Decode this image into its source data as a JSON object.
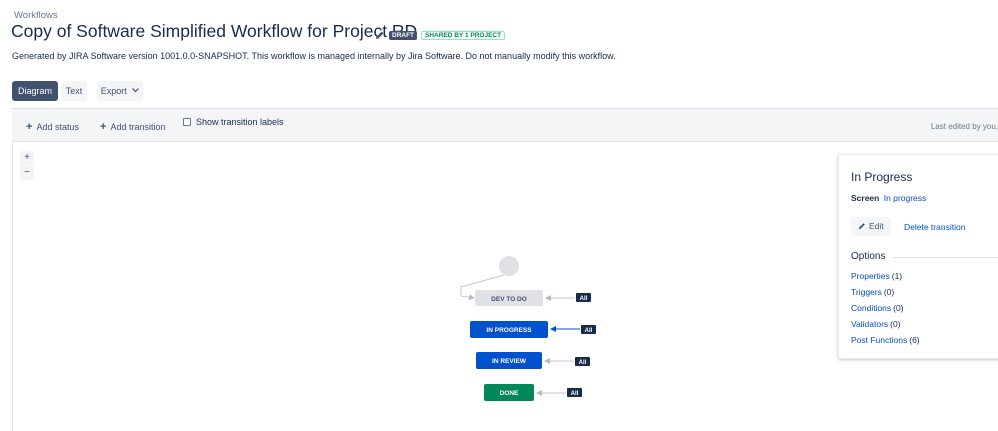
{
  "header": {
    "breadcrumb": "Workflows",
    "title": "Copy of Software Simplified Workflow for Project RD",
    "draft_badge": "DRAFT",
    "shared_badge": "SHARED BY 1 PROJECT",
    "description": "Generated by JIRA Software version 1001.0.0-SNAPSHOT. This workflow is managed internally by Jira Software. Do not manually modify this workflow."
  },
  "tabs": {
    "diagram": "Diagram",
    "text": "Text",
    "export": "Export"
  },
  "toolbar": {
    "add_status": "Add status",
    "add_transition": "Add transition",
    "show_labels": "Show transition labels",
    "show_labels_checked": false,
    "last_edited": "Last edited by you,"
  },
  "zoom": {
    "in": "+",
    "out": "−"
  },
  "statuses": [
    {
      "label": "DEV TO DO",
      "color": "#dfe1e6",
      "text_color": "#42526e",
      "global_label": "All"
    },
    {
      "label": "IN PROGRESS",
      "color": "#0052cc",
      "text_color": "#ffffff",
      "global_label": "All"
    },
    {
      "label": "IN REVIEW",
      "color": "#0052cc",
      "text_color": "#ffffff",
      "global_label": "All"
    },
    {
      "label": "DONE",
      "color": "#00875a",
      "text_color": "#ffffff",
      "global_label": "All"
    }
  ],
  "panel": {
    "title": "In Progress",
    "screen_label": "Screen",
    "screen_value": "In progress",
    "edit": "Edit",
    "delete": "Delete transition",
    "options_heading": "Options",
    "options": [
      {
        "label": "Properties",
        "count": "(1)"
      },
      {
        "label": "Triggers",
        "count": "(0)"
      },
      {
        "label": "Conditions",
        "count": "(0)"
      },
      {
        "label": "Validators",
        "count": "(0)"
      },
      {
        "label": "Post Functions",
        "count": "(6)"
      }
    ]
  }
}
